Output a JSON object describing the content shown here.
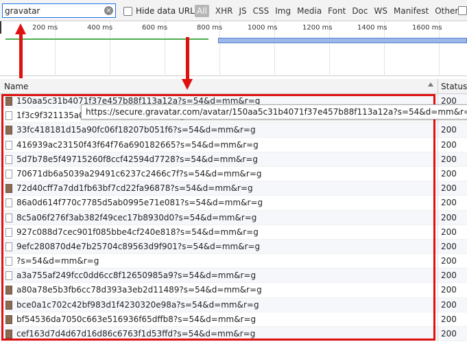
{
  "filter": {
    "search_value": "gravatar",
    "clear_icon": "clear-search-icon",
    "hide_data_urls_label": "Hide data URLs",
    "types": [
      "All",
      "XHR",
      "JS",
      "CSS",
      "Img",
      "Media",
      "Font",
      "Doc",
      "WS",
      "Manifest",
      "Other"
    ]
  },
  "overview": {
    "ticks": [
      "200 ms",
      "400 ms",
      "600 ms",
      "800 ms",
      "1000 ms",
      "1200 ms",
      "1400 ms",
      "1600 ms"
    ]
  },
  "table": {
    "name_header": "Name",
    "status_header": "Status",
    "rows": [
      {
        "name": "150aa5c31b4071f37e457b88f113a12a?s=54&d=mm&r=g",
        "status": "200",
        "icon": "image-file-icon"
      },
      {
        "name": "1f3c9f321135a019...?s=54&d=mm&r=g",
        "status": "200",
        "icon": "file-icon"
      },
      {
        "name": "33fc418181d15a90fc06f18207b051f6?s=54&d=mm&r=g",
        "status": "200",
        "icon": "image-file-icon"
      },
      {
        "name": "416939ac23150f43f64f76a690182665?s=54&d=mm&r=g",
        "status": "200",
        "icon": "file-icon"
      },
      {
        "name": "5d7b78e5f49715260f8ccf42594d7728?s=54&d=mm&r=g",
        "status": "200",
        "icon": "file-icon"
      },
      {
        "name": "70671db6a5039a29491c6237c2466c7f?s=54&d=mm&r=g",
        "status": "200",
        "icon": "file-icon"
      },
      {
        "name": "72d40cff7a7dd1fb63bf7cd22fa96878?s=54&d=mm&r=g",
        "status": "200",
        "icon": "image-file-icon"
      },
      {
        "name": "86a0d614f770c7785d5ab0995e71e081?s=54&d=mm&r=g",
        "status": "200",
        "icon": "file-icon"
      },
      {
        "name": "8c5a06f276f3ab382f49cec17b8930d0?s=54&d=mm&r=g",
        "status": "200",
        "icon": "file-icon"
      },
      {
        "name": "927c088d7cec901f085bbe4cf240e818?s=54&d=mm&r=g",
        "status": "200",
        "icon": "file-icon"
      },
      {
        "name": "9efc280870d4e7b25704c89563d9f901?s=54&d=mm&r=g",
        "status": "200",
        "icon": "file-icon"
      },
      {
        "name": "?s=54&d=mm&r=g",
        "status": "200",
        "icon": "file-icon"
      },
      {
        "name": "a3a755af249fcc0dd6cc8f12650985a9?s=54&d=mm&r=g",
        "status": "200",
        "icon": "file-icon"
      },
      {
        "name": "a80a78e5b3fb6cc78d393a3eb2d11489?s=54&d=mm&r=g",
        "status": "200",
        "icon": "image-file-icon"
      },
      {
        "name": "bce0a1c702c42bf983d1f4230320e98a?s=54&d=mm&r=g",
        "status": "200",
        "icon": "image-file-icon"
      },
      {
        "name": "bf54536da7050c663e516936f65dffb8?s=54&d=mm&r=g",
        "status": "200",
        "icon": "image-file-icon"
      },
      {
        "name": "cef163d7d4d67d16d86c6763f1d53ffd?s=54&d=mm&r=g",
        "status": "200",
        "icon": "image-file-icon"
      }
    ]
  },
  "tooltip": {
    "text": "https://secure.gravatar.com/avatar/150aa5c31b4071f37e457b88f113a12a?s=54&d=mm&r=g"
  },
  "colors": {
    "annotation": "#e01010",
    "accent": "#1a73e8"
  }
}
